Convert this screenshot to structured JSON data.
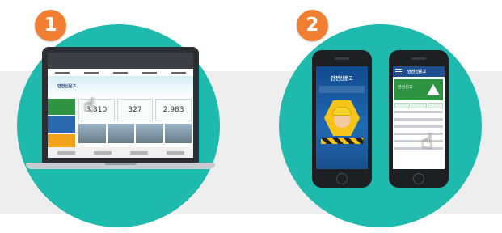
{
  "steps": [
    {
      "number": "1",
      "device": "laptop"
    },
    {
      "number": "2",
      "device": "phones"
    }
  ],
  "laptop_website": {
    "brand_text": "안전신문고",
    "stats": [
      "3,310",
      "327",
      "2,983"
    ]
  },
  "phone_splash": {
    "logo_text": "안전신문고"
  },
  "phone_app": {
    "title": "안전신문고",
    "hero_label": "안전신고"
  },
  "icons": {
    "cursor": "hand-pointer-icon",
    "warning": "warning-triangle-icon",
    "menu": "hamburger-menu-icon"
  },
  "colors": {
    "circle": "#1ebaad",
    "badge": "#f07f32",
    "band": "#eeeeef",
    "app_header": "#1f4f8f",
    "app_hero": "#2f9441"
  }
}
